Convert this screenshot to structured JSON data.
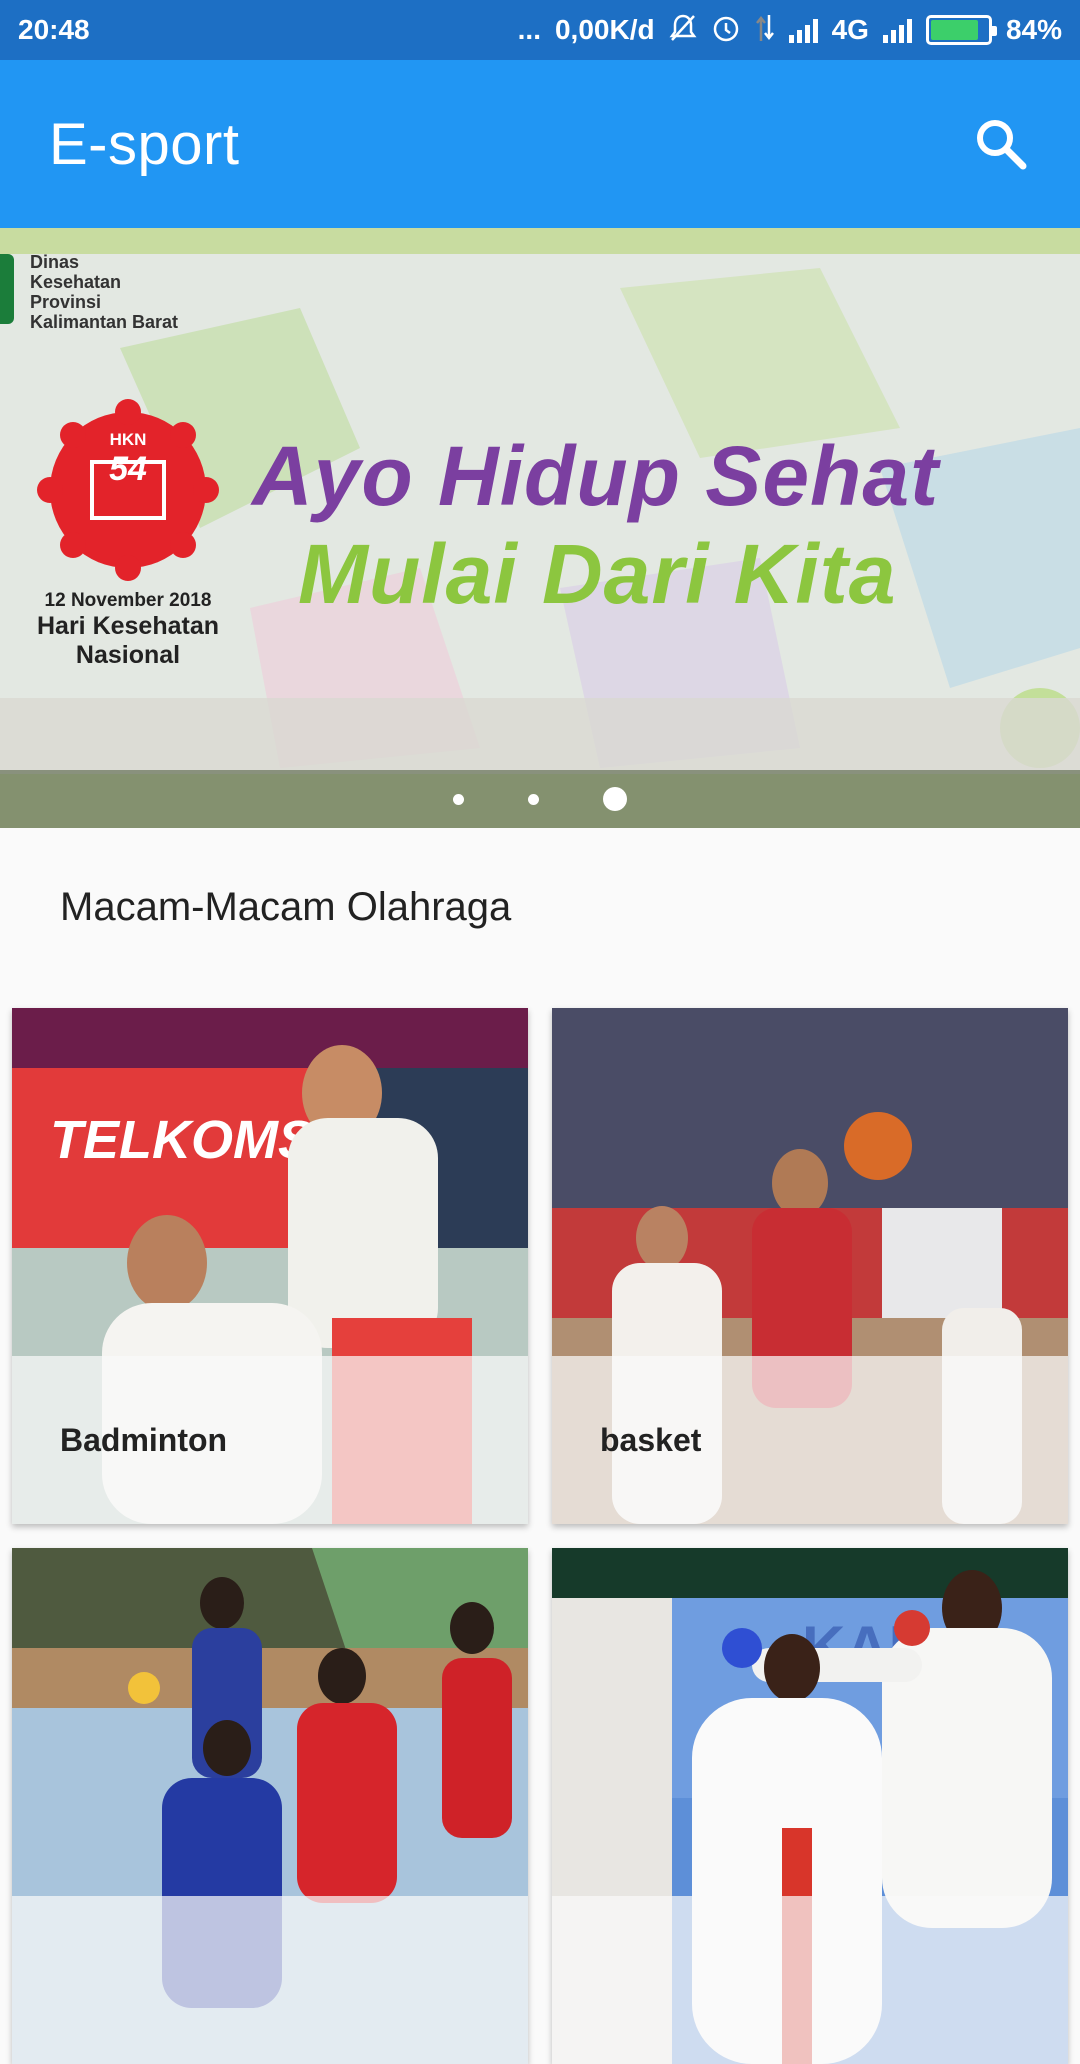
{
  "status_bar": {
    "time": "20:48",
    "dots": "...",
    "speed": "0,00K/d",
    "network": "4G",
    "battery": "84%",
    "battery_level": 0.84,
    "icons": [
      "mute-icon",
      "alarm-icon",
      "data-arrows-icon",
      "signal-icon",
      "signal-icon",
      "battery-icon"
    ]
  },
  "app_bar": {
    "title": "E-sport",
    "search_icon": "search-icon",
    "color": "#2196f3"
  },
  "banner": {
    "agency": [
      "Dinas",
      "Kesehatan",
      "Provinsi",
      "Kalimantan Barat"
    ],
    "logo_text": "HKN",
    "logo_number": "54",
    "date": "12 November 2018",
    "event": [
      "Hari Kesehatan",
      "Nasional"
    ],
    "headline": "Ayo Hidup Sehat",
    "subheadline": "Mulai Dari Kita",
    "slide_count": 3,
    "active_slide": 3,
    "headline_color": "#7b3fa0",
    "subheadline_color": "#8cc63f"
  },
  "section": {
    "title": "Macam-Macam Olahraga"
  },
  "sports": [
    {
      "label": "Badminton",
      "image": "badminton-photo"
    },
    {
      "label": "basket",
      "image": "basketball-photo"
    },
    {
      "label": "",
      "image": "handball-photo"
    },
    {
      "label": "",
      "image": "karate-photo"
    }
  ]
}
